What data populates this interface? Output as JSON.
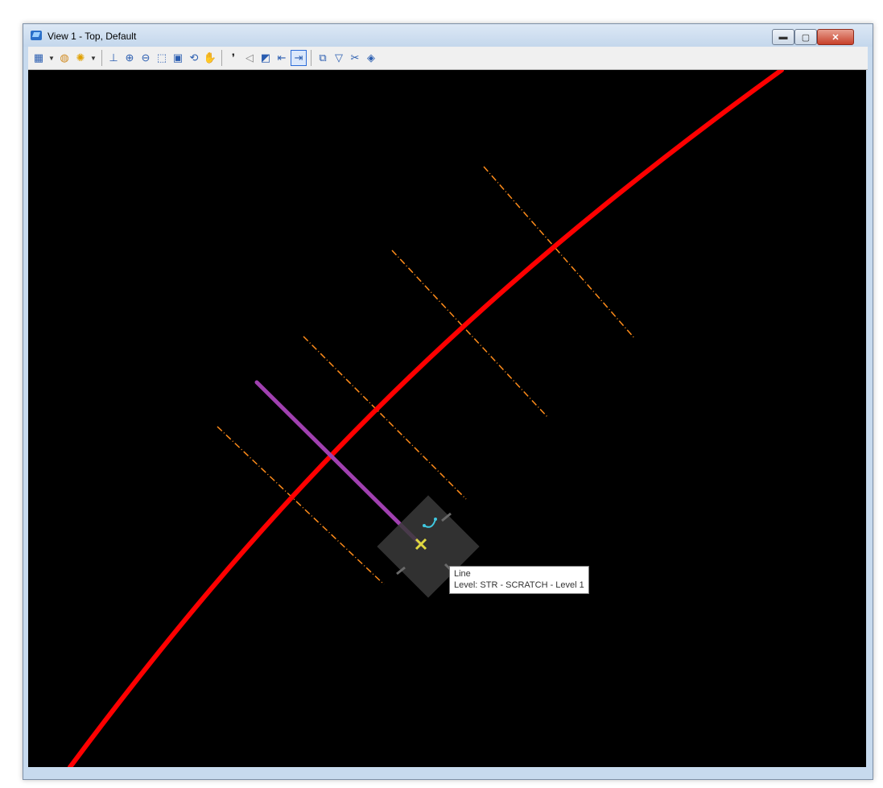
{
  "window": {
    "title": "View 1 - Top, Default",
    "controls": {
      "minimize": "▬",
      "maximize": "▢",
      "close": "✕"
    }
  },
  "toolbar": {
    "items": [
      "view-attributes-icon",
      "dropdown-arrow-icon",
      "display-style-icon",
      "lighting-icon",
      "dropdown-arrow-icon",
      "update-view-icon",
      "zoom-in-icon",
      "zoom-out-icon",
      "window-area-icon",
      "fit-view-icon",
      "rotate-view-icon",
      "pan-view-icon",
      "walk-icon",
      "view-previous-icon",
      "view-next-icon",
      "copy-view-icon",
      "clip-volume-icon",
      "clip-mask-icon",
      "camera-icon"
    ]
  },
  "colors": {
    "viewport_bg": "#000000",
    "alignment": "#ff0000",
    "offsets": "#ff8c1a",
    "line": "#a040b0",
    "tooltip_bg": "#ffffff"
  },
  "tooltip": {
    "line1": "Line",
    "line2": "Level: STR - SCRATCH - Level 1"
  }
}
